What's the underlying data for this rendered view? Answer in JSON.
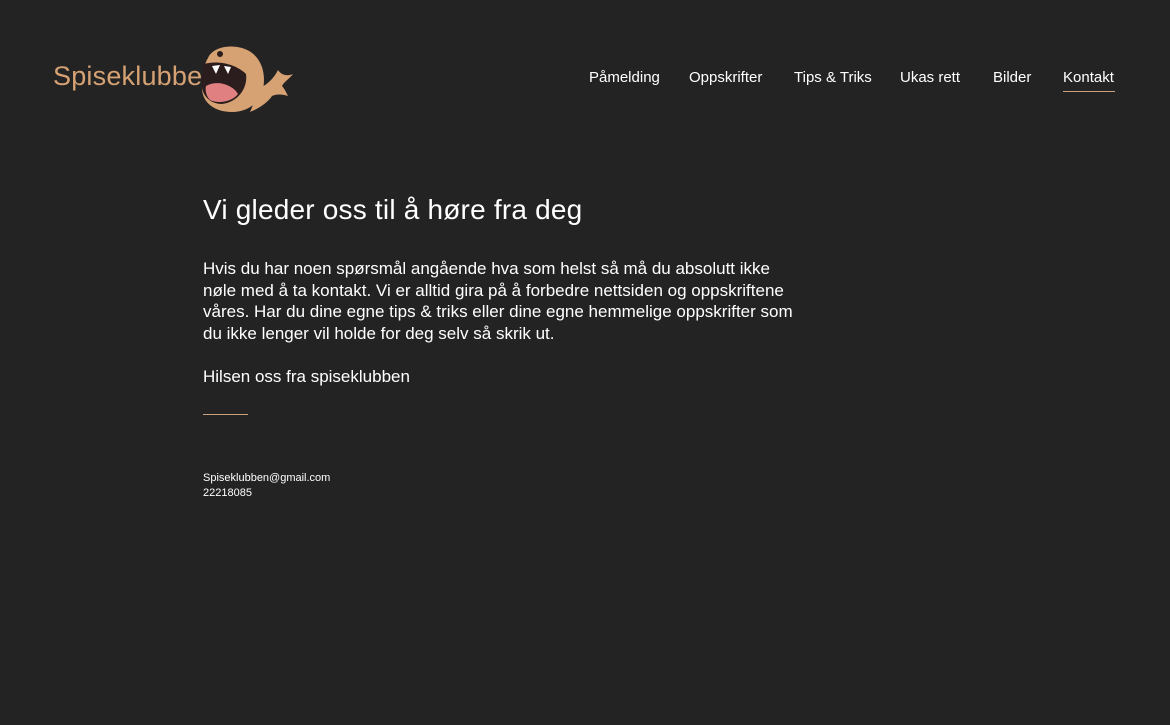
{
  "brand": {
    "name": "Spiseklubben",
    "logo_icon": "whale-icon",
    "color": "#d6a274"
  },
  "nav": {
    "items": [
      {
        "label": "Påmelding"
      },
      {
        "label": "Oppskrifter"
      },
      {
        "label": "Tips & Triks"
      },
      {
        "label": "Ukas rett"
      },
      {
        "label": "Bilder"
      },
      {
        "label": "Kontakt",
        "active": true
      }
    ]
  },
  "main": {
    "heading": "Vi gleder oss til å høre fra deg",
    "intro": "Hvis du har noen spørsmål angående hva som helst så må du absolutt ikke nøle med å ta kontakt. Vi er alltid gira på å forbedre nettsiden og oppskriftene våres. Har du dine egne tips & triks eller dine egne hemmelige oppskrifter som du ikke lenger vil holde for deg selv så skrik ut.",
    "greeting": "Hilsen oss fra spiseklubben"
  },
  "contact": {
    "email": "Spiseklubben@gmail.com",
    "phone": "22218085"
  },
  "colors": {
    "background": "#232323",
    "accent": "#c9a27d",
    "text": "#ffffff"
  }
}
